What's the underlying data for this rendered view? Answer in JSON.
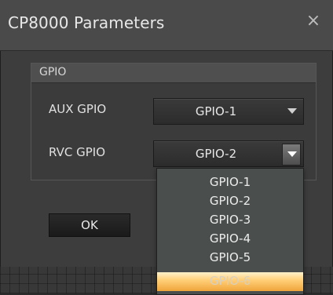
{
  "window": {
    "title": "CP8000 Parameters",
    "close_label": "×"
  },
  "group": {
    "title": "GPIO",
    "aux": {
      "label": "AUX GPIO",
      "value": "GPIO-1"
    },
    "rvc": {
      "label": "RVC GPIO",
      "value": "GPIO-2"
    }
  },
  "dropdown": {
    "options": [
      "GPIO-1",
      "GPIO-2",
      "GPIO-3",
      "GPIO-4",
      "GPIO-5",
      "GPIO-6"
    ],
    "selected_index": 5
  },
  "buttons": {
    "ok_label": "OK"
  },
  "colors": {
    "highlight": "#f4b24b",
    "background": "#3d3d3d"
  }
}
